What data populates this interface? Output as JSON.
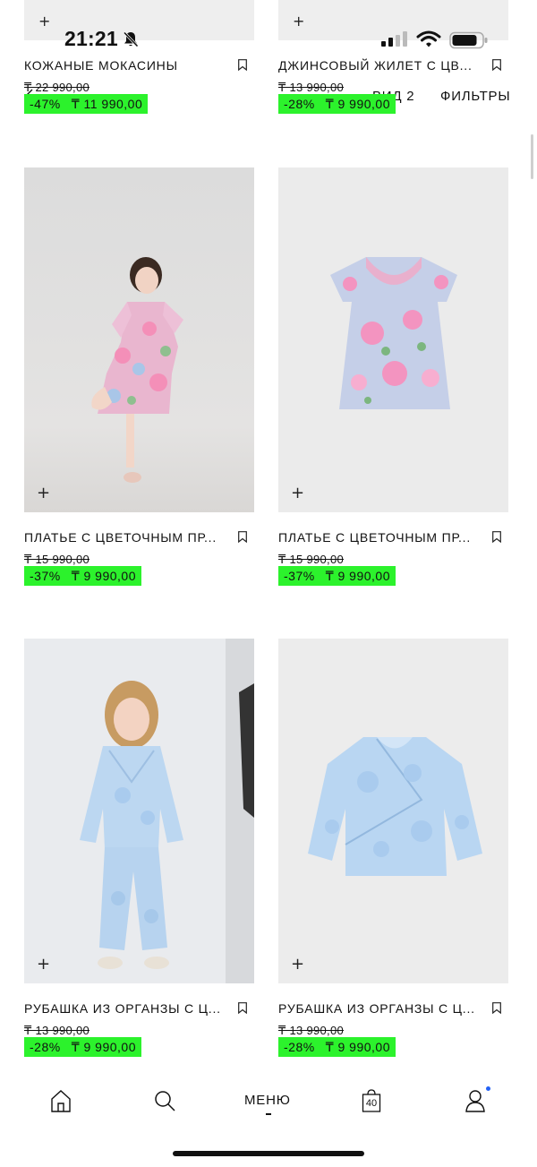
{
  "status_bar": {
    "time": "21:21"
  },
  "nav": {
    "view_label": "ВИД 2",
    "filters_label": "ФИЛЬТРЫ"
  },
  "products": [
    {
      "name": "КОЖАНЫЕ МОКАСИНЫ",
      "old_price": "₸ 22 990,00",
      "discount": "-47%",
      "price": "₸ 11 990,00"
    },
    {
      "name": "ДЖИНСОВЫЙ ЖИЛЕТ С ЦВ...",
      "old_price": "₸ 13 990,00",
      "discount": "-28%",
      "price": "₸ 9 990,00"
    },
    {
      "name": "ПЛАТЬЕ С ЦВЕТОЧНЫМ ПР...",
      "old_price": "₸ 15 990,00",
      "discount": "-37%",
      "price": "₸ 9 990,00"
    },
    {
      "name": "ПЛАТЬЕ С ЦВЕТОЧНЫМ ПР...",
      "old_price": "₸ 15 990,00",
      "discount": "-37%",
      "price": "₸ 9 990,00"
    },
    {
      "name": "РУБАШКА ИЗ ОРГАНЗЫ С Ц...",
      "old_price": "₸ 13 990,00",
      "discount": "-28%",
      "price": "₸ 9 990,00"
    },
    {
      "name": "РУБАШКА ИЗ ОРГАНЗЫ С Ц...",
      "old_price": "₸ 13 990,00",
      "discount": "-28%",
      "price": "₸ 9 990,00"
    }
  ],
  "bottom_nav": {
    "menu_label": "МЕНЮ",
    "cart_count": "40",
    "icons": [
      "home-icon",
      "search-icon",
      "cart-icon",
      "account-icon"
    ]
  },
  "colors": {
    "sale_badge": "#2cf22c",
    "notification_dot": "#2462f5"
  }
}
